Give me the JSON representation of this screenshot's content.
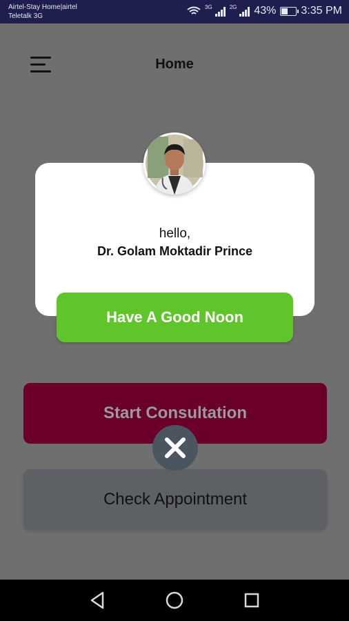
{
  "status_bar": {
    "carrier_line1": "Airtel-Stay Home|airtel",
    "carrier_line2": "Teletalk 3G",
    "network1": "3G",
    "network2": "2G",
    "battery": "43%",
    "battery_level": 0.43,
    "time": "3:35 PM"
  },
  "header": {
    "title": "Home"
  },
  "welcome_card": {
    "greeting": "hello,",
    "doctor_name": "Dr. Golam Moktadir Prince",
    "message_button": "Have A Good Noon"
  },
  "actions": {
    "start_label": "Start Consultation",
    "appointment_label": "Check Appointment"
  },
  "colors": {
    "green": "#5fc52a",
    "maroon": "#6a0029",
    "overlay": "#6f6f6f",
    "statusbar": "#1f1f4f"
  },
  "icons": {
    "menu": "menu-icon",
    "close": "close-icon",
    "back": "back-icon",
    "home": "home-icon",
    "recents": "recents-icon"
  }
}
